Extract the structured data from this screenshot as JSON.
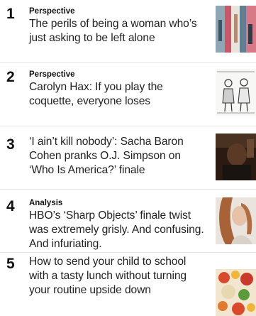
{
  "most_read": {
    "items": [
      {
        "rank": "1",
        "label": "Perspective",
        "headline": "The perils of being a woman who’s just asking to be left alone",
        "thumb_icon": "illustration-thumbnail"
      },
      {
        "rank": "2",
        "label": "Perspective",
        "headline": "Carolyn Hax: If you play the coquette, everyone loses",
        "thumb_icon": "cartoon-thumbnail"
      },
      {
        "rank": "3",
        "label": "",
        "headline": "‘I ain’t kill nobody’: Sacha Baron Cohen pranks O.J. Simpson on ‘Who Is America?’ finale",
        "thumb_icon": "photo-thumbnail"
      },
      {
        "rank": "4",
        "label": "Analysis",
        "headline": "HBO’s ‘Sharp Objects’ finale twist was extremely grisly. And confusing. And infuriating.",
        "thumb_icon": "photo-thumbnail"
      },
      {
        "rank": "5",
        "label": "",
        "headline": "How to send your child to school with a tasty lunch without turning your routine upside down",
        "thumb_icon": "food-photo-thumbnail"
      }
    ]
  }
}
